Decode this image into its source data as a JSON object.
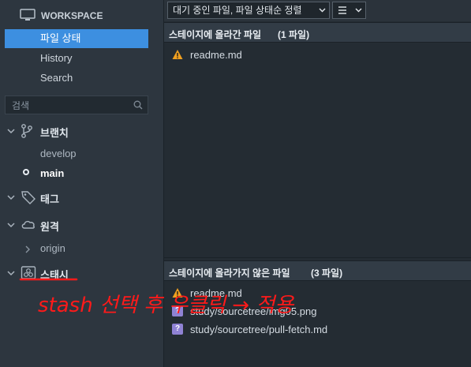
{
  "sidebar": {
    "workspace_label": "WORKSPACE",
    "nav": [
      {
        "label": "파일 상태",
        "active": true
      },
      {
        "label": "History",
        "active": false
      },
      {
        "label": "Search",
        "active": false
      }
    ],
    "search_placeholder": "검색",
    "sections": {
      "branches": {
        "label": "브랜치",
        "items": [
          "develop",
          "main"
        ],
        "current": "main"
      },
      "tags": {
        "label": "태그"
      },
      "remotes": {
        "label": "원격",
        "items": [
          "origin"
        ]
      },
      "stashes": {
        "label": "스태시"
      }
    }
  },
  "toolbar": {
    "filter_select": "대기 중인 파일, 파일 상태순 정렬",
    "view_menu_icon": "list-icon"
  },
  "staged": {
    "title": "스테이지에 올라간 파일",
    "count": "(1 파일)",
    "files": [
      {
        "name": "readme.md",
        "status": "modified",
        "icon": "warning-icon"
      }
    ]
  },
  "unstaged": {
    "title": "스테이지에 올라가지 않은 파일",
    "count": "(3 파일)",
    "files": [
      {
        "name": "readme.md",
        "status": "modified",
        "icon": "warning-icon"
      },
      {
        "name": "study/sourcetree/img05.png",
        "status": "untracked",
        "icon": "question-icon"
      },
      {
        "name": "study/sourcetree/pull-fetch.md",
        "status": "untracked",
        "icon": "question-icon"
      }
    ]
  },
  "annotation": {
    "text": "stash 선택 후 우클릭 → 적용",
    "color": "#ff1a1a"
  },
  "colors": {
    "accent": "#3d8fe0",
    "warning": "#f0a020",
    "untracked": "#8f82d4"
  }
}
